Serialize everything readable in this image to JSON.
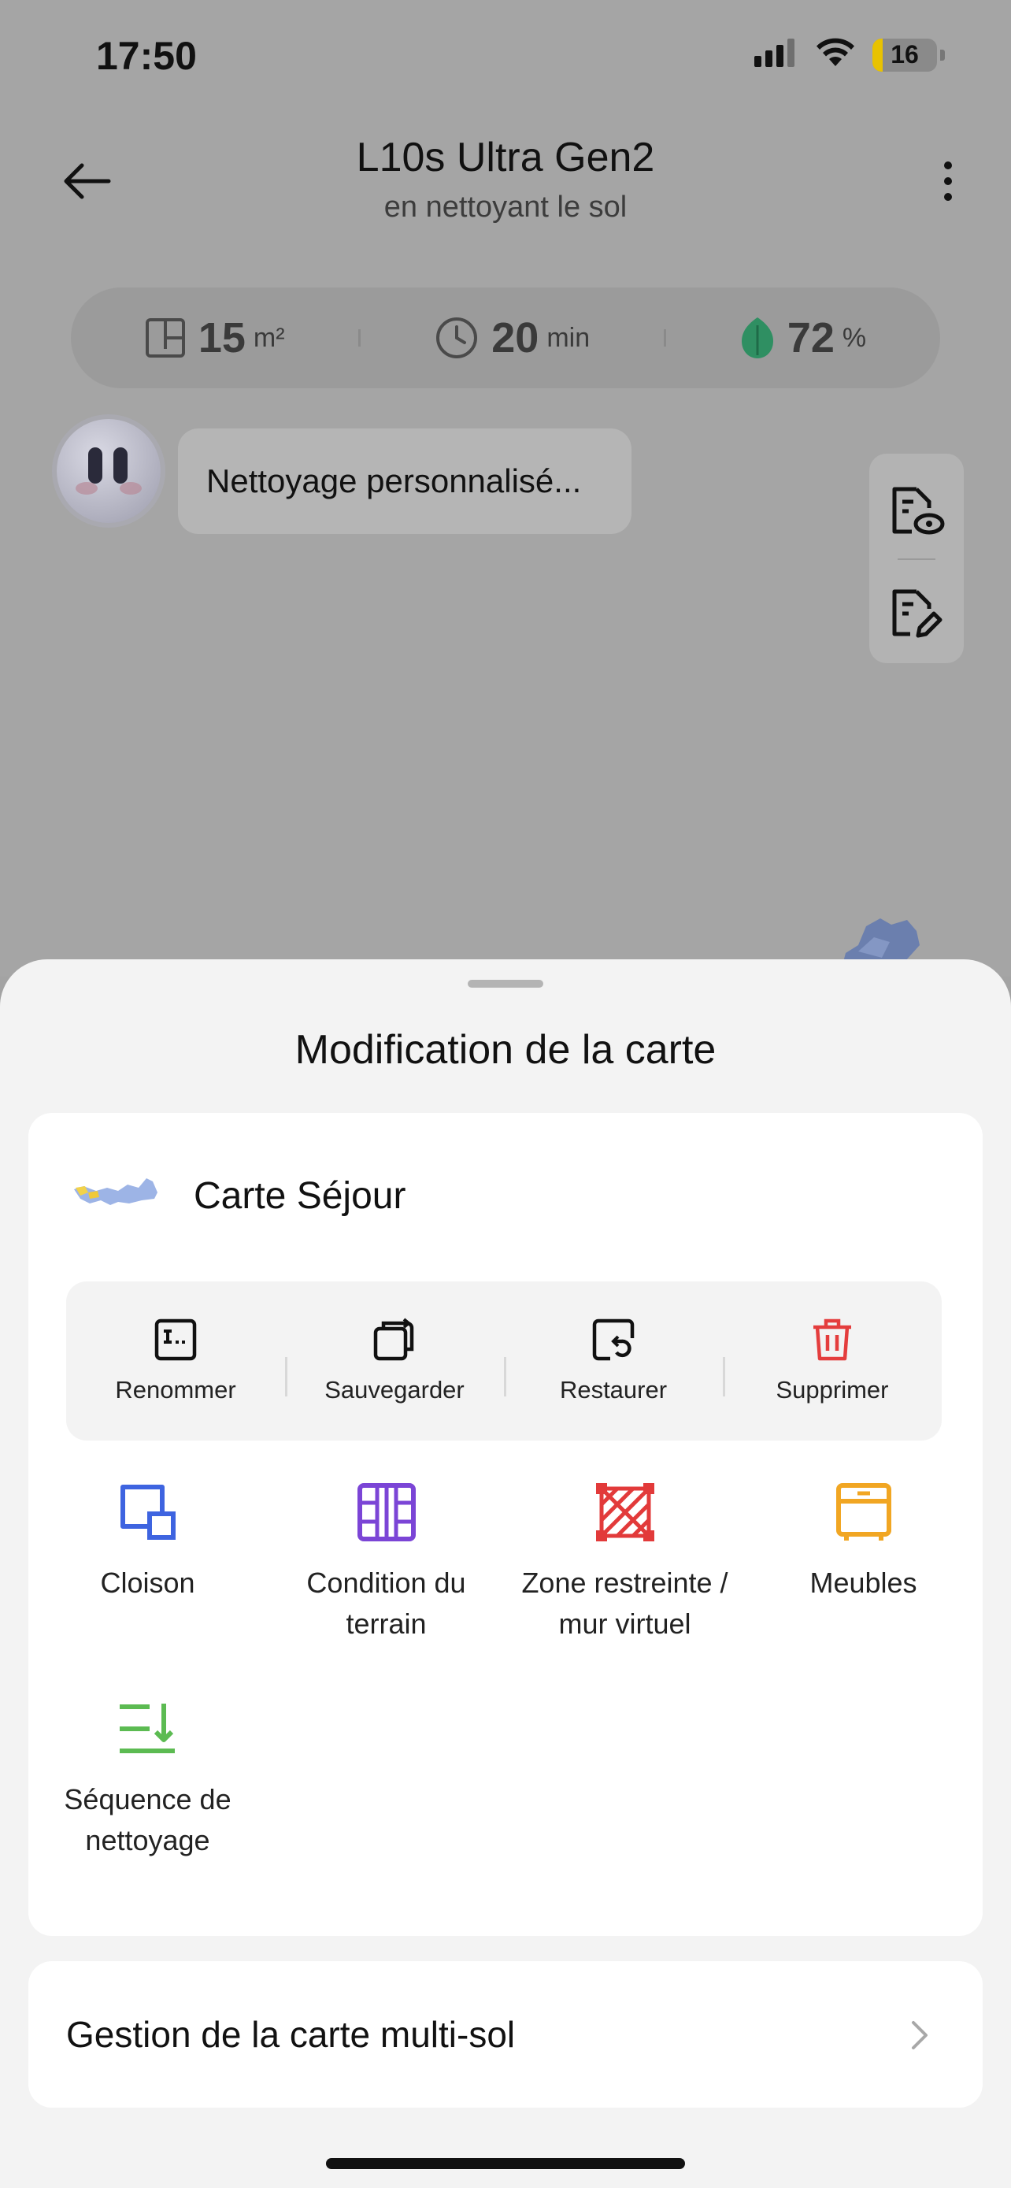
{
  "status_bar": {
    "time": "17:50",
    "battery": "16",
    "battery_level": 0.16,
    "battery_color": "#e8c200"
  },
  "header": {
    "title": "L10s Ultra Gen2",
    "subtitle": "en nettoyant le sol"
  },
  "stats": [
    {
      "icon": "area-icon",
      "value": "15",
      "unit": "m²"
    },
    {
      "icon": "clock-icon",
      "value": "20",
      "unit": "min"
    },
    {
      "icon": "battery-leaf-icon",
      "value": "72",
      "unit": "%"
    }
  ],
  "assistant": {
    "message": "Nettoyage personnalisé..."
  },
  "sheet": {
    "title": "Modification de la carte",
    "map_name": "Carte Séjour",
    "actions": [
      {
        "label": "Renommer",
        "icon": "rename-icon",
        "color": "#111111"
      },
      {
        "label": "Sauvegarder",
        "icon": "save-icon",
        "color": "#111111"
      },
      {
        "label": "Restaurer",
        "icon": "restore-icon",
        "color": "#111111"
      },
      {
        "label": "Supprimer",
        "icon": "trash-icon",
        "color": "#e43d3d"
      }
    ],
    "tools": [
      {
        "label": "Cloison",
        "icon": "partition-icon",
        "color": "#3e64e0"
      },
      {
        "label": "Condition du terrain",
        "icon": "floor-condition-icon",
        "color": "#7b45d6"
      },
      {
        "label": "Zone restreinte / mur virtuel",
        "icon": "restricted-zone-icon",
        "color": "#e23a3a"
      },
      {
        "label": "Meubles",
        "icon": "furniture-icon",
        "color": "#f1a623"
      },
      {
        "label": "Séquence de nettoyage",
        "icon": "cleaning-sequence-icon",
        "color": "#5cbb52"
      }
    ],
    "multi_floor": "Gestion de la carte multi-sol"
  }
}
